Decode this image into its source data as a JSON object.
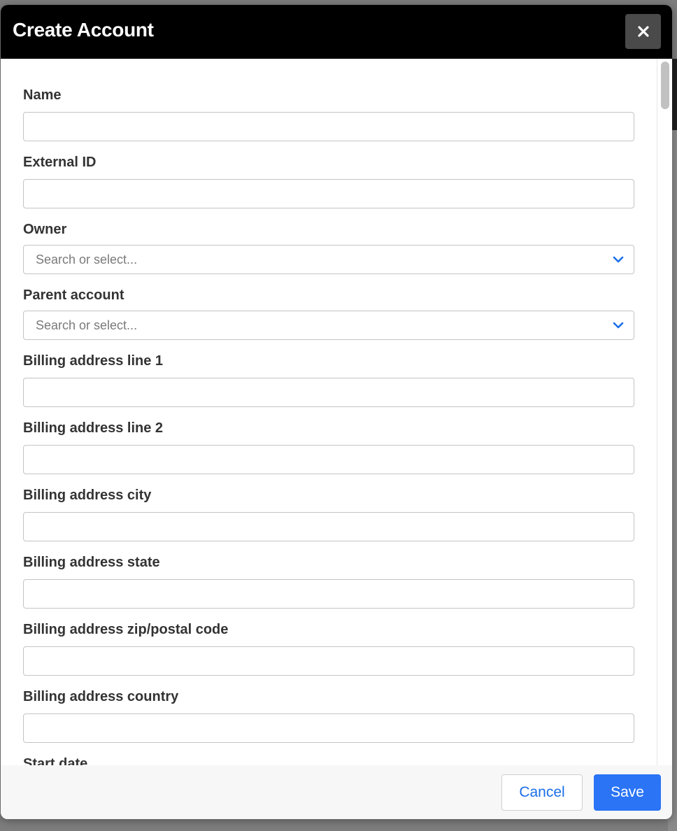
{
  "modal": {
    "title": "Create Account",
    "close_icon": "close-icon"
  },
  "fields": {
    "name": {
      "label": "Name",
      "value": ""
    },
    "external_id": {
      "label": "External ID",
      "value": ""
    },
    "owner": {
      "label": "Owner",
      "placeholder": "Search or select...",
      "icon": "chevron-down-icon"
    },
    "parent_account": {
      "label": "Parent account",
      "placeholder": "Search or select...",
      "icon": "chevron-down-icon"
    },
    "billing_line1": {
      "label": "Billing address line 1",
      "value": ""
    },
    "billing_line2": {
      "label": "Billing address line 2",
      "value": ""
    },
    "billing_city": {
      "label": "Billing address city",
      "value": ""
    },
    "billing_state": {
      "label": "Billing address state",
      "value": ""
    },
    "billing_zip": {
      "label": "Billing address zip/postal code",
      "value": ""
    },
    "billing_country": {
      "label": "Billing address country",
      "value": ""
    },
    "start_date": {
      "label": "Start date"
    }
  },
  "footer": {
    "cancel_label": "Cancel",
    "save_label": "Save"
  },
  "colors": {
    "header_bg": "#000000",
    "primary": "#2a74f5",
    "link": "#1a6fe8",
    "chevron": "#1a6fe8"
  }
}
